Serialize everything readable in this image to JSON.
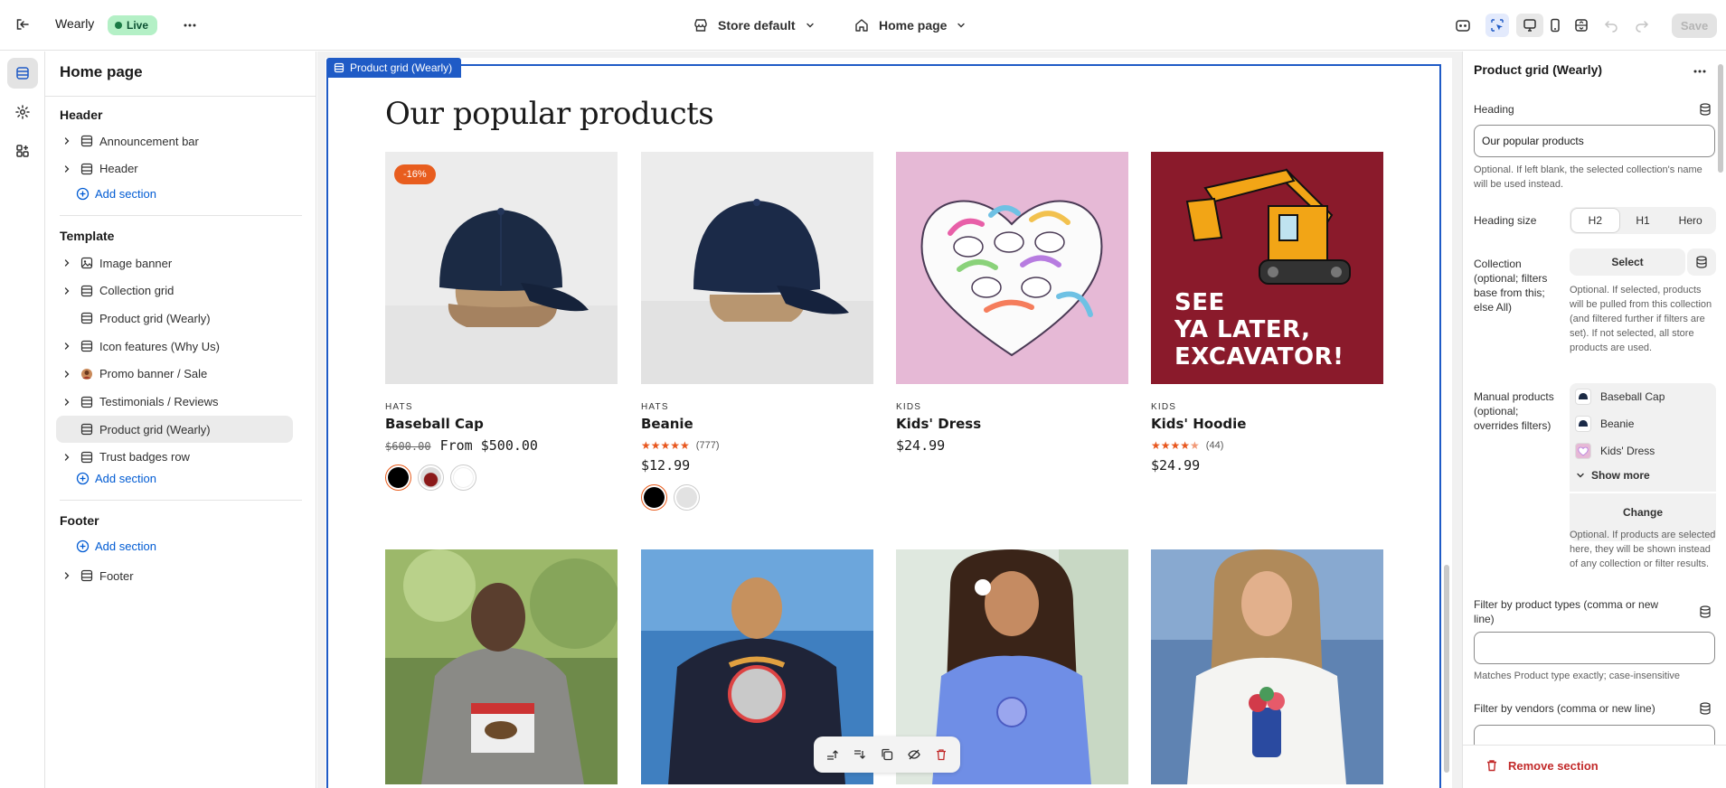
{
  "topbar": {
    "store_name": "Wearly",
    "status_badge": "Live",
    "store_select_label": "Store default",
    "page_select_label": "Home page",
    "save_label": "Save"
  },
  "sidebar": {
    "title": "Home page",
    "header_group": "Header",
    "header_items": [
      {
        "label": "Announcement bar",
        "icon": "section-icon",
        "expandable": true
      },
      {
        "label": "Header",
        "icon": "section-icon",
        "expandable": true
      }
    ],
    "add_section_label": "Add section",
    "template_group": "Template",
    "template_items": [
      {
        "label": "Image banner",
        "icon": "image-icon",
        "expandable": true
      },
      {
        "label": "Collection grid",
        "icon": "section-icon",
        "expandable": true
      },
      {
        "label": "Product grid (Wearly)",
        "icon": "section-icon",
        "expandable": false
      },
      {
        "label": "Icon features (Why Us)",
        "icon": "section-icon",
        "expandable": true
      },
      {
        "label": "Promo banner / Sale",
        "icon": "thumbnail-icon",
        "expandable": true
      },
      {
        "label": "Testimonials / Reviews",
        "icon": "section-icon",
        "expandable": true
      },
      {
        "label": "Product grid (Wearly)",
        "icon": "section-icon",
        "expandable": false,
        "selected": true
      },
      {
        "label": "Trust badges row",
        "icon": "section-icon",
        "expandable": true
      }
    ],
    "footer_group": "Footer",
    "footer_items": [
      {
        "label": "Footer",
        "icon": "section-icon",
        "expandable": true
      }
    ]
  },
  "preview": {
    "section_tag": "Product grid (Wearly)",
    "heading": "Our popular products",
    "products": [
      {
        "category": "HATS",
        "name": "Baseball Cap",
        "discount": "-16%",
        "old_price": "$600.00",
        "price": "From $500.00",
        "rating": null,
        "reviews": null,
        "swatches": [
          "#000000",
          "#8b1a1a",
          "#ffffff"
        ]
      },
      {
        "category": "HATS",
        "name": "Beanie",
        "discount": null,
        "old_price": null,
        "price": "$12.99",
        "rating": 5,
        "reviews": "(777)",
        "swatches": [
          "#000000",
          "#e2e2e2"
        ]
      },
      {
        "category": "KIDS",
        "name": "Kids' Dress",
        "discount": null,
        "old_price": null,
        "price": "$24.99",
        "rating": null,
        "reviews": null,
        "swatches": []
      },
      {
        "category": "KIDS",
        "name": "Kids' Hoodie",
        "discount": null,
        "old_price": null,
        "price": "$24.99",
        "rating": 4.5,
        "reviews": "(44)",
        "swatches": []
      }
    ],
    "excavator_text": [
      "SEE",
      "YA LATER,",
      "EXCAVATOR!"
    ]
  },
  "panel": {
    "title": "Product grid (Wearly)",
    "heading_label": "Heading",
    "heading_value": "Our popular products",
    "heading_help": "Optional. If left blank, the selected collection's name will be used instead.",
    "heading_size_label": "Heading size",
    "heading_size_options": [
      "H2",
      "H1",
      "Hero"
    ],
    "heading_size_selected": "H2",
    "collection_label": "Collection (optional; filters base from this; else All)",
    "collection_button": "Select",
    "collection_help": "Optional. If selected, products will be pulled from this collection (and filtered further if filters are set). If not selected, all store products are used.",
    "manual_label": "Manual products (optional; overrides filters)",
    "manual_products": [
      "Baseball Cap",
      "Beanie",
      "Kids' Dress"
    ],
    "show_more": "Show more",
    "change_button": "Change",
    "manual_help": "Optional. If products are selected here, they will be shown instead of any collection or filter results.",
    "filter_types_label": "Filter by product types (comma or new line)",
    "filter_types_value": "",
    "filter_types_help": "Matches Product type exactly; case-insensitive",
    "filter_vendors_label": "Filter by vendors (comma or new line)",
    "filter_vendors_value": "",
    "remove_section": "Remove section"
  },
  "colors": {
    "accent_blue": "#1f5bc6",
    "link_blue": "#005bd3",
    "live_green": "#b4f0c6",
    "discount_orange": "#e85d1e",
    "danger_red": "#c22a2a"
  }
}
